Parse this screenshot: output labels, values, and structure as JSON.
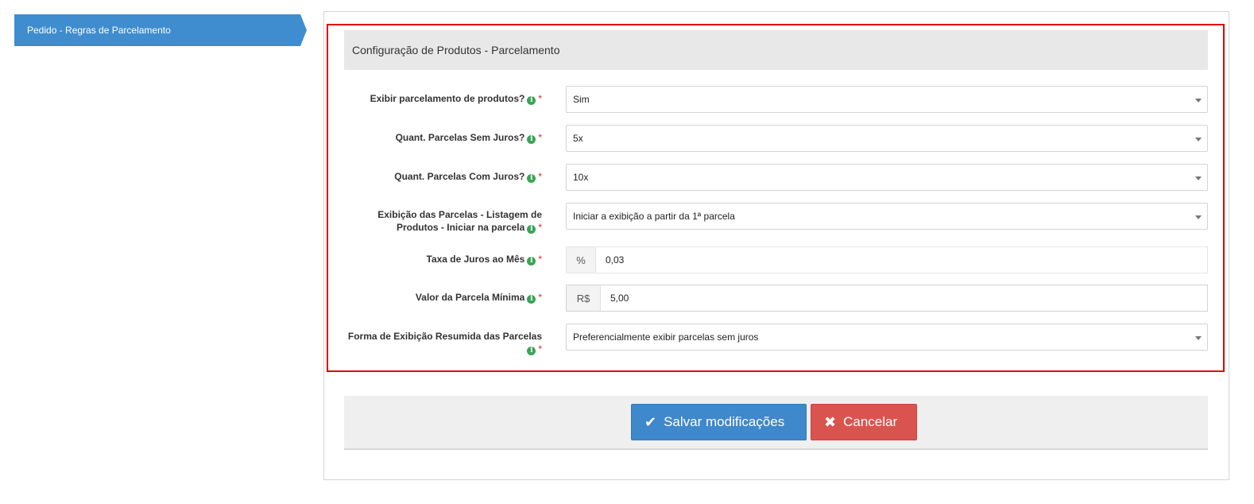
{
  "sidebar": {
    "tab_label": "Pedido - Regras de Parcelamento"
  },
  "section": {
    "title": "Configuração de Produtos - Parcelamento"
  },
  "fields": [
    {
      "label": "Exibir parcelamento de produtos?",
      "value": "Sim",
      "type": "select"
    },
    {
      "label": "Quant. Parcelas Sem Juros?",
      "value": "5x",
      "type": "select"
    },
    {
      "label": "Quant. Parcelas Com Juros?",
      "value": "10x",
      "type": "select"
    },
    {
      "label_line1": "Exibição das Parcelas - Listagem de",
      "label_line2": "Produtos - Iniciar na parcela",
      "value": "Iniciar a exibição a partir da 1ª parcela",
      "type": "select"
    },
    {
      "label": "Taxa de Juros ao Mês",
      "addon": "%",
      "value": "0,03",
      "type": "input"
    },
    {
      "label": "Valor da Parcela Mínima",
      "addon": "R$",
      "value": "5,00",
      "type": "input"
    },
    {
      "label_line1": "Forma de Exibição Resumida das Parcelas",
      "value": "Preferencialmente exibir parcelas sem juros",
      "type": "select"
    }
  ],
  "required_marker": "*",
  "info_glyph": "i",
  "actions": {
    "save_label": "Salvar modificações",
    "save_icon": "check-icon",
    "cancel_label": "Cancelar",
    "cancel_icon": "close-icon"
  },
  "colors": {
    "primary": "#3f88cc",
    "danger": "#d9534f",
    "info": "#3aa455",
    "highlight": "#e00000"
  }
}
